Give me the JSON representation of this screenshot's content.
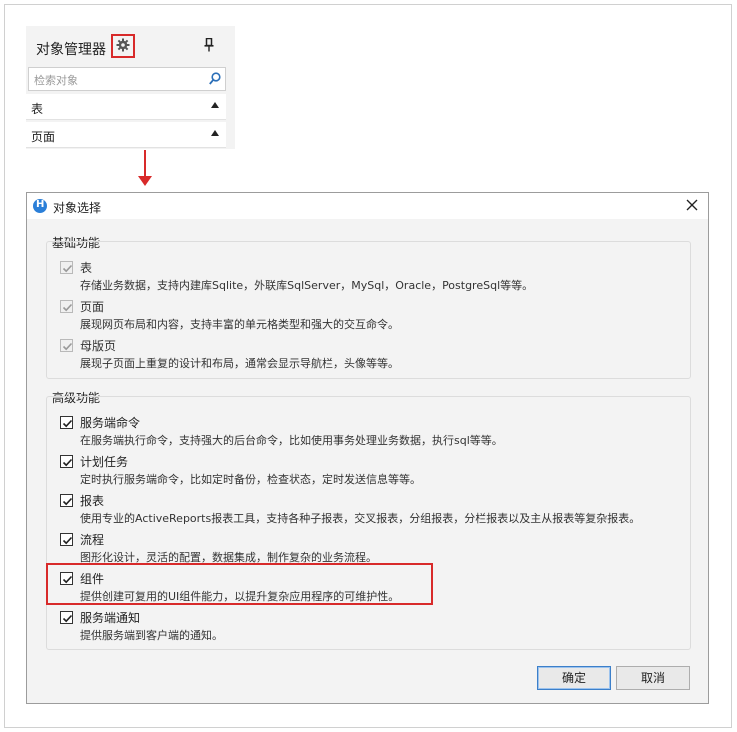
{
  "object_manager": {
    "title": "对象管理器",
    "search_placeholder": "检索对象",
    "sections": [
      "表",
      "页面"
    ]
  },
  "dialog": {
    "title": "对象选择",
    "basic_group": {
      "title": "基础功能",
      "items": [
        {
          "label": "表",
          "desc": "存储业务数据，支持内建库Sqlite，外联库SqlServer，MySql，Oracle，PostgreSql等等。",
          "checked": true,
          "enabled": false
        },
        {
          "label": "页面",
          "desc": "展现网页布局和内容，支持丰富的单元格类型和强大的交互命令。",
          "checked": true,
          "enabled": false
        },
        {
          "label": "母版页",
          "desc": "展现子页面上重复的设计和布局，通常会显示导航栏，头像等等。",
          "checked": true,
          "enabled": false
        }
      ]
    },
    "advanced_group": {
      "title": "高级功能",
      "items": [
        {
          "label": "服务端命令",
          "desc": "在服务端执行命令，支持强大的后台命令，比如使用事务处理业务数据，执行sql等等。",
          "checked": true
        },
        {
          "label": "计划任务",
          "desc": "定时执行服务端命令，比如定时备份，检查状态，定时发送信息等等。",
          "checked": true
        },
        {
          "label": "报表",
          "desc": "使用专业的ActiveReports报表工具，支持各种子报表，交叉报表，分组报表，分栏报表以及主从报表等复杂报表。",
          "checked": true
        },
        {
          "label": "流程",
          "desc": "图形化设计，灵活的配置，数据集成，制作复杂的业务流程。",
          "checked": true
        },
        {
          "label": "组件",
          "desc": "提供创建可复用的UI组件能力，以提升复杂应用程序的可维护性。",
          "checked": true
        },
        {
          "label": "服务端通知",
          "desc": "提供服务端到客户端的通知。",
          "checked": true
        }
      ]
    },
    "ok_label": "确定",
    "cancel_label": "取消"
  },
  "colors": {
    "highlight": "#d82a2a",
    "accent": "#2b7fd8"
  }
}
